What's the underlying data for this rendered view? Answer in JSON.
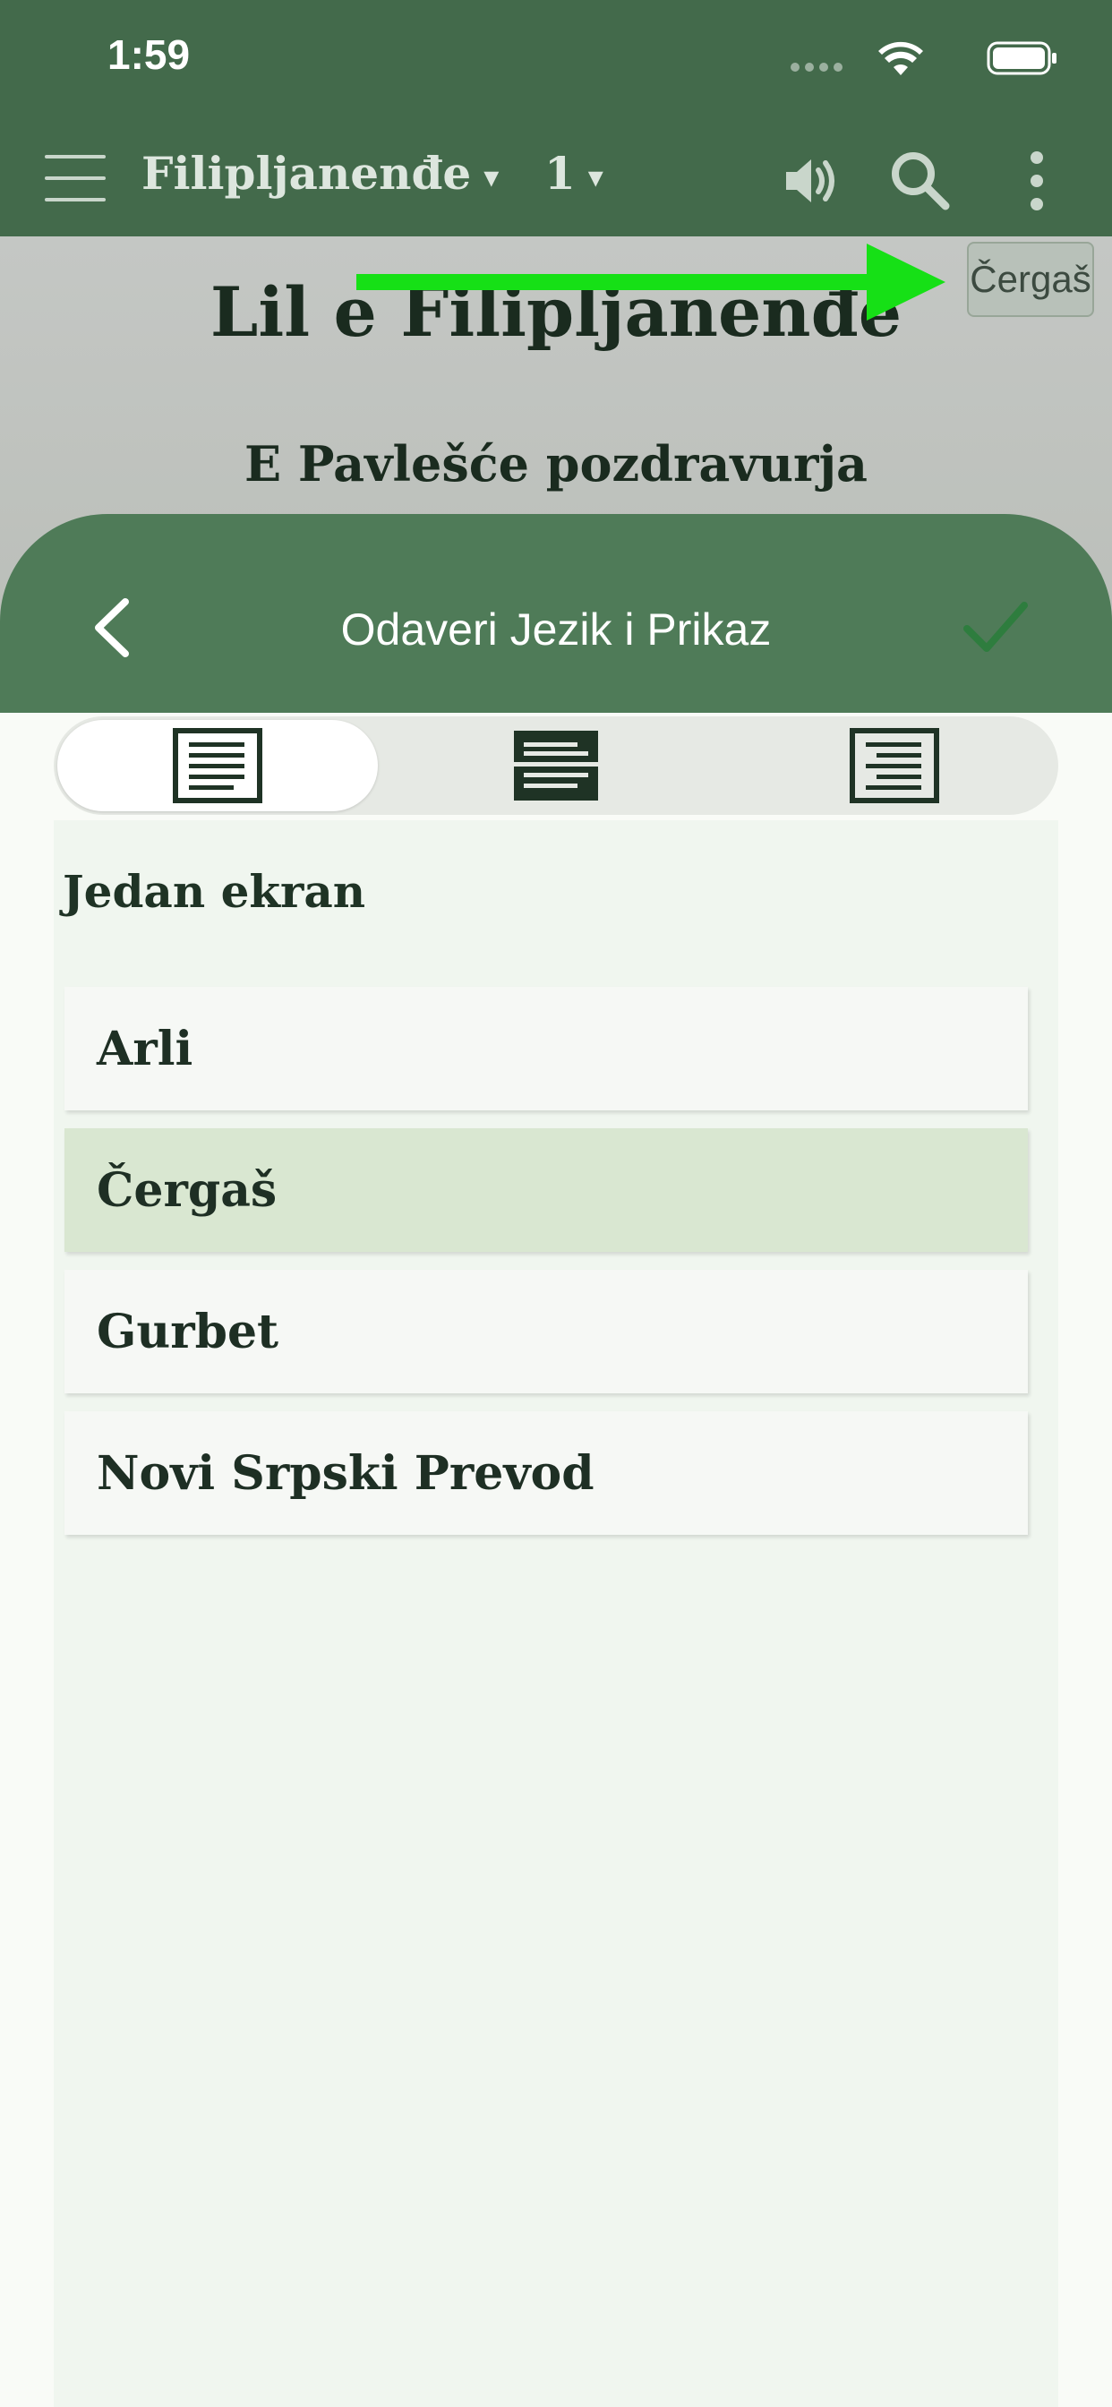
{
  "status_bar": {
    "time": "1:59"
  },
  "app_bar": {
    "book": "Filipljanenđe",
    "chapter": "1",
    "caret": "▾"
  },
  "reading": {
    "chapter_heading": "Lil e Filipljanenđe",
    "section_heading": "E Pavlešće pozdravurja",
    "language_chip": "Čergaš"
  },
  "sheet": {
    "title": "Odaveri Jezik i Prikaz",
    "section_label": "Jedan ekran",
    "items": [
      {
        "label": "Arli",
        "selected": false
      },
      {
        "label": "Čergaš",
        "selected": true
      },
      {
        "label": "Gurbet",
        "selected": false
      },
      {
        "label": "Novi Srpski Prevod",
        "selected": false
      }
    ]
  },
  "colors": {
    "app_bar": "#436a4b",
    "sheet_header": "#4f7b58",
    "selected_row": "#d9e7d1",
    "check": "#2e7d3e",
    "annotation_arrow": "#16e016"
  },
  "icons": {
    "menu": "hamburger-icon",
    "speaker": "speaker-icon",
    "search": "search-icon",
    "more": "more-vertical-icon",
    "back": "chevron-left-icon",
    "confirm": "check-icon",
    "layouts": [
      "single-pane-icon",
      "split-pane-icon",
      "verse-layout-icon"
    ]
  }
}
